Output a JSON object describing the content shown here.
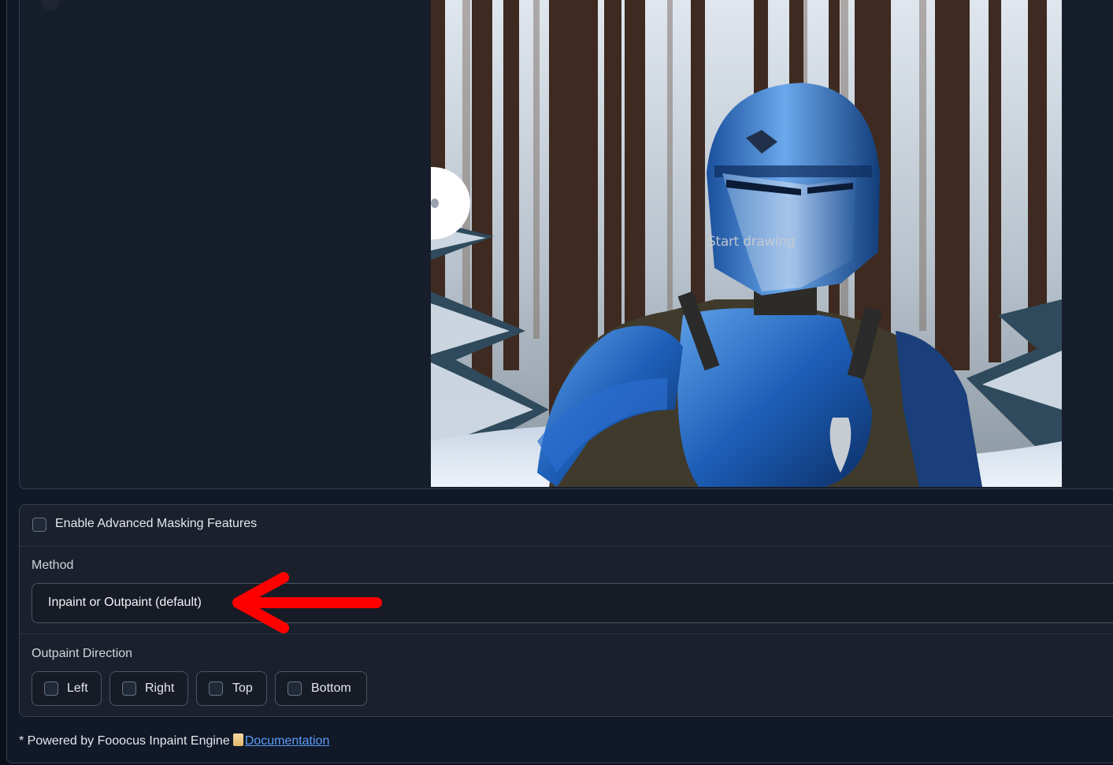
{
  "canvas": {
    "status_text": "Start drawing"
  },
  "options": {
    "advanced_masking_label": "Enable Advanced Masking Features",
    "method_label": "Method",
    "method_value": "Inpaint or Outpaint (default)",
    "outpaint_direction_label": "Outpaint Direction",
    "directions": [
      "Left",
      "Right",
      "Top",
      "Bottom"
    ]
  },
  "footer": {
    "powered_by": "* Powered by Fooocus Inpaint Engine",
    "doc_icon": "scroll-icon",
    "doc_link": "Documentation"
  },
  "colors": {
    "annotation_arrow": "#ff0000",
    "link": "#5b9cf7",
    "armor_blue": "#1d5fb8"
  }
}
